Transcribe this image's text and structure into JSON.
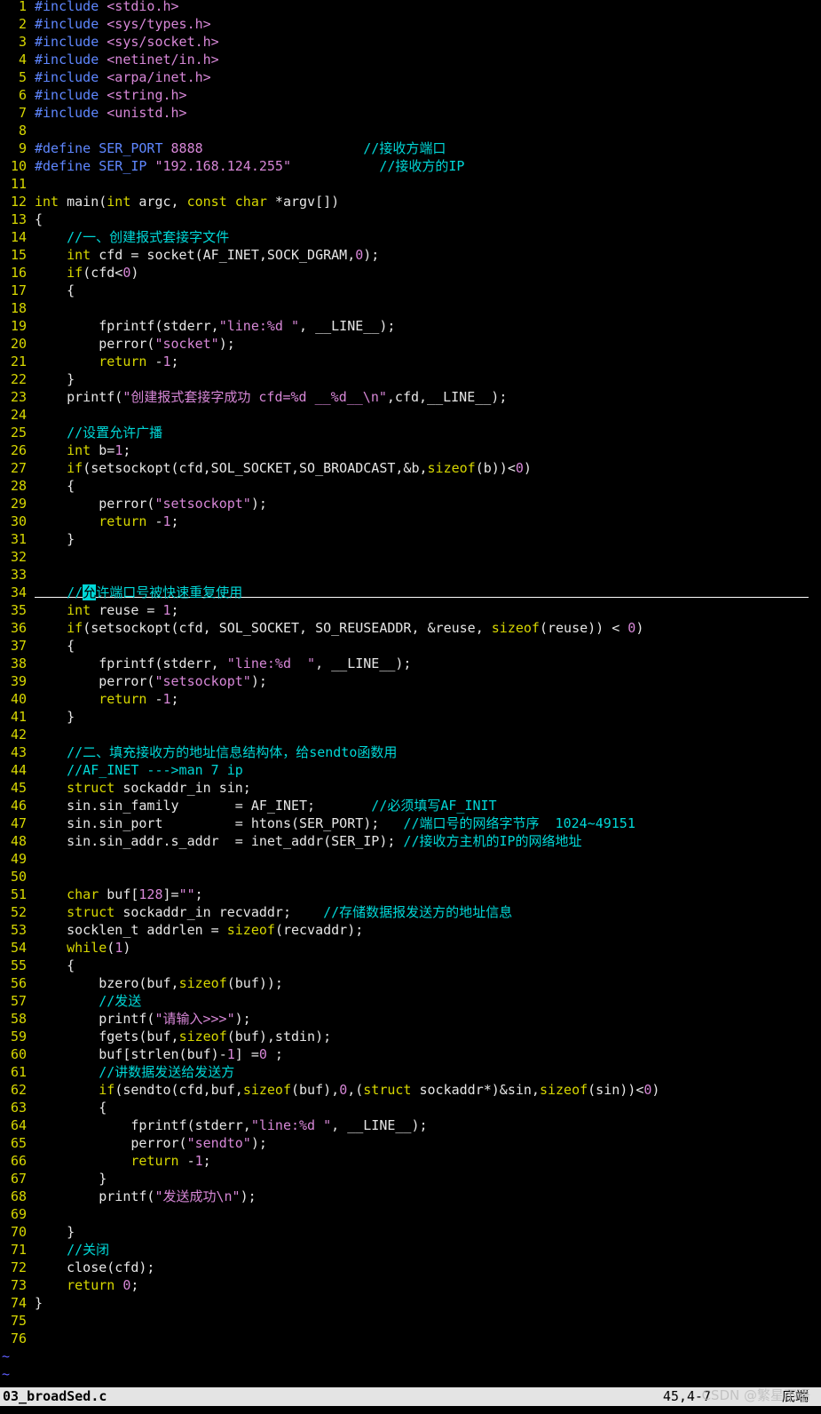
{
  "filename": "03_broadSed.c",
  "cursor_pos": "45,4-7",
  "scroll_pos": "底端",
  "watermark": "CSDN @繁星不语",
  "colors": {
    "background": "#000000",
    "line_number": "#d7d700",
    "comment": "#00d7d7",
    "string": "#d787d7",
    "keyword": "#d7d700",
    "preprocessor": "#5f87ff",
    "statusbar": "#e4e4e4"
  },
  "lines": [
    [
      [
        "pp",
        "#include "
      ],
      [
        "inc",
        "<stdio.h>"
      ]
    ],
    [
      [
        "pp",
        "#include "
      ],
      [
        "inc",
        "<sys/types.h>"
      ]
    ],
    [
      [
        "pp",
        "#include "
      ],
      [
        "inc",
        "<sys/socket.h>"
      ]
    ],
    [
      [
        "pp",
        "#include "
      ],
      [
        "inc",
        "<netinet/in.h>"
      ]
    ],
    [
      [
        "pp",
        "#include "
      ],
      [
        "inc",
        "<arpa/inet.h>"
      ]
    ],
    [
      [
        "pp",
        "#include "
      ],
      [
        "inc",
        "<string.h>"
      ]
    ],
    [
      [
        "pp",
        "#include "
      ],
      [
        "inc",
        "<unistd.h>"
      ]
    ],
    [],
    [
      [
        "pp",
        "#define SER_PORT "
      ],
      [
        "num",
        "8888"
      ],
      [
        "",
        "                    "
      ],
      [
        "cmt",
        "//接收方端口"
      ]
    ],
    [
      [
        "pp",
        "#define SER_IP "
      ],
      [
        "str",
        "\"192.168.124.255\""
      ],
      [
        "",
        "           "
      ],
      [
        "cmt",
        "//接收方的IP"
      ]
    ],
    [],
    [
      [
        "ty",
        "int"
      ],
      [
        "",
        " main("
      ],
      [
        "ty",
        "int"
      ],
      [
        "",
        " argc, "
      ],
      [
        "ty",
        "const"
      ],
      [
        "",
        " "
      ],
      [
        "ty",
        "char"
      ],
      [
        "",
        " *argv[])"
      ]
    ],
    [
      [
        "",
        "{"
      ]
    ],
    [
      [
        "",
        "    "
      ],
      [
        "cmt",
        "//一、创建报式套接字文件"
      ]
    ],
    [
      [
        "",
        "    "
      ],
      [
        "ty",
        "int"
      ],
      [
        "",
        " cfd = socket(AF_INET,SOCK_DGRAM,"
      ],
      [
        "num",
        "0"
      ],
      [
        "",
        ");"
      ]
    ],
    [
      [
        "",
        "    "
      ],
      [
        "kw",
        "if"
      ],
      [
        "",
        "(cfd<"
      ],
      [
        "num",
        "0"
      ],
      [
        "",
        ")"
      ]
    ],
    [
      [
        "",
        "    {"
      ]
    ],
    [],
    [
      [
        "",
        "        fprintf(stderr,"
      ],
      [
        "str",
        "\"line:%d \""
      ],
      [
        "",
        ", __LINE__);"
      ]
    ],
    [
      [
        "",
        "        perror("
      ],
      [
        "str",
        "\"socket\""
      ],
      [
        "",
        ");"
      ]
    ],
    [
      [
        "",
        "        "
      ],
      [
        "kw",
        "return"
      ],
      [
        "",
        " -"
      ],
      [
        "num",
        "1"
      ],
      [
        "",
        ";"
      ]
    ],
    [
      [
        "",
        "    }"
      ]
    ],
    [
      [
        "",
        "    printf("
      ],
      [
        "str",
        "\"创建报式套接字成功 cfd=%d __%d__\\n\""
      ],
      [
        "",
        ",cfd,__LINE__);"
      ]
    ],
    [],
    [
      [
        "",
        "    "
      ],
      [
        "cmt",
        "//设置允许广播"
      ]
    ],
    [
      [
        "",
        "    "
      ],
      [
        "ty",
        "int"
      ],
      [
        "",
        " b="
      ],
      [
        "num",
        "1"
      ],
      [
        "",
        ";"
      ]
    ],
    [
      [
        "",
        "    "
      ],
      [
        "kw",
        "if"
      ],
      [
        "",
        "(setsockopt(cfd,SOL_SOCKET,SO_BROADCAST,&b,"
      ],
      [
        "kw",
        "sizeof"
      ],
      [
        "",
        "(b))<"
      ],
      [
        "num",
        "0"
      ],
      [
        "",
        ")"
      ]
    ],
    [
      [
        "",
        "    {"
      ]
    ],
    [
      [
        "",
        "        perror("
      ],
      [
        "str",
        "\"setsockopt\""
      ],
      [
        "",
        ");"
      ]
    ],
    [
      [
        "",
        "        "
      ],
      [
        "kw",
        "return"
      ],
      [
        "",
        " -"
      ],
      [
        "num",
        "1"
      ],
      [
        "",
        ";"
      ]
    ],
    [
      [
        "",
        "    }"
      ]
    ],
    [],
    [],
    [
      [
        "",
        "    "
      ],
      [
        "cmt",
        "//"
      ],
      [
        "cursor",
        "允"
      ],
      [
        "cmt",
        "许端口号被快速重复使用"
      ]
    ],
    [
      [
        "",
        "    "
      ],
      [
        "ty",
        "int"
      ],
      [
        "",
        " reuse = "
      ],
      [
        "num",
        "1"
      ],
      [
        "",
        ";"
      ]
    ],
    [
      [
        "",
        "    "
      ],
      [
        "kw",
        "if"
      ],
      [
        "",
        "(setsockopt(cfd, SOL_SOCKET, SO_REUSEADDR, &reuse, "
      ],
      [
        "kw",
        "sizeof"
      ],
      [
        "",
        "(reuse)) < "
      ],
      [
        "num",
        "0"
      ],
      [
        "",
        ")"
      ]
    ],
    [
      [
        "",
        "    {"
      ]
    ],
    [
      [
        "",
        "        fprintf(stderr, "
      ],
      [
        "str",
        "\"line:%d  \""
      ],
      [
        "",
        ", __LINE__);"
      ]
    ],
    [
      [
        "",
        "        perror("
      ],
      [
        "str",
        "\"setsockopt\""
      ],
      [
        "",
        ");"
      ]
    ],
    [
      [
        "",
        "        "
      ],
      [
        "kw",
        "return"
      ],
      [
        "",
        " -"
      ],
      [
        "num",
        "1"
      ],
      [
        "",
        ";"
      ]
    ],
    [
      [
        "",
        "    }"
      ]
    ],
    [],
    [
      [
        "",
        "    "
      ],
      [
        "cmt",
        "//二、填充接收方的地址信息结构体，给sendto函数用"
      ]
    ],
    [
      [
        "",
        "    "
      ],
      [
        "cmt",
        "//AF_INET --->man 7 ip"
      ]
    ],
    [
      [
        "",
        "    "
      ],
      [
        "ty",
        "struct"
      ],
      [
        "",
        " sockaddr_in sin;"
      ]
    ],
    [
      [
        "",
        "    sin.sin_family       = AF_INET;       "
      ],
      [
        "cmt",
        "//必须填写AF_INIT"
      ]
    ],
    [
      [
        "",
        "    sin.sin_port         = htons(SER_PORT);   "
      ],
      [
        "cmt",
        "//端口号的网络字节序  1024~49151"
      ]
    ],
    [
      [
        "",
        "    sin.sin_addr.s_addr  = inet_addr(SER_IP); "
      ],
      [
        "cmt",
        "//接收方主机的IP的网络地址"
      ]
    ],
    [],
    [],
    [
      [
        "",
        "    "
      ],
      [
        "ty",
        "char"
      ],
      [
        "",
        " buf["
      ],
      [
        "num",
        "128"
      ],
      [
        "",
        "]="
      ],
      [
        "str",
        "\"\""
      ],
      [
        "",
        ";"
      ]
    ],
    [
      [
        "",
        "    "
      ],
      [
        "ty",
        "struct"
      ],
      [
        "",
        " sockaddr_in recvaddr;    "
      ],
      [
        "cmt",
        "//存储数据报发送方的地址信息"
      ]
    ],
    [
      [
        "",
        "    socklen_t addrlen = "
      ],
      [
        "kw",
        "sizeof"
      ],
      [
        "",
        "(recvaddr);"
      ]
    ],
    [
      [
        "",
        "    "
      ],
      [
        "kw",
        "while"
      ],
      [
        "",
        "("
      ],
      [
        "num",
        "1"
      ],
      [
        "",
        ")"
      ]
    ],
    [
      [
        "",
        "    {"
      ]
    ],
    [
      [
        "",
        "        bzero(buf,"
      ],
      [
        "kw",
        "sizeof"
      ],
      [
        "",
        "(buf));"
      ]
    ],
    [
      [
        "",
        "        "
      ],
      [
        "cmt",
        "//发送"
      ]
    ],
    [
      [
        "",
        "        printf("
      ],
      [
        "str",
        "\"请输入>>>\""
      ],
      [
        "",
        ");"
      ]
    ],
    [
      [
        "",
        "        fgets(buf,"
      ],
      [
        "kw",
        "sizeof"
      ],
      [
        "",
        "(buf),stdin);"
      ]
    ],
    [
      [
        "",
        "        buf[strlen(buf)-"
      ],
      [
        "num",
        "1"
      ],
      [
        "",
        "] ="
      ],
      [
        "num",
        "0"
      ],
      [
        "",
        " ;"
      ]
    ],
    [
      [
        "",
        "        "
      ],
      [
        "cmt",
        "//讲数据发送给发送方"
      ]
    ],
    [
      [
        "",
        "        "
      ],
      [
        "kw",
        "if"
      ],
      [
        "",
        "(sendto(cfd,buf,"
      ],
      [
        "kw",
        "sizeof"
      ],
      [
        "",
        "(buf),"
      ],
      [
        "num",
        "0"
      ],
      [
        "",
        ",("
      ],
      [
        "ty",
        "struct"
      ],
      [
        "",
        " sockaddr*)&sin,"
      ],
      [
        "kw",
        "sizeof"
      ],
      [
        "",
        "(sin))<"
      ],
      [
        "num",
        "0"
      ],
      [
        "",
        ")"
      ]
    ],
    [
      [
        "",
        "        {"
      ]
    ],
    [
      [
        "",
        "            fprintf(stderr,"
      ],
      [
        "str",
        "\"line:%d \""
      ],
      [
        "",
        ", __LINE__);"
      ]
    ],
    [
      [
        "",
        "            perror("
      ],
      [
        "str",
        "\"sendto\""
      ],
      [
        "",
        ");"
      ]
    ],
    [
      [
        "",
        "            "
      ],
      [
        "kw",
        "return"
      ],
      [
        "",
        " -"
      ],
      [
        "num",
        "1"
      ],
      [
        "",
        ";"
      ]
    ],
    [
      [
        "",
        "        }"
      ]
    ],
    [
      [
        "",
        "        printf("
      ],
      [
        "str",
        "\"发送成功\\n\""
      ],
      [
        "",
        ");"
      ]
    ],
    [],
    [
      [
        "",
        "    }"
      ]
    ],
    [
      [
        "",
        "    "
      ],
      [
        "cmt",
        "//关闭"
      ]
    ],
    [
      [
        "",
        "    close(cfd);"
      ]
    ],
    [
      [
        "",
        "    "
      ],
      [
        "kw",
        "return"
      ],
      [
        "",
        " "
      ],
      [
        "num",
        "0"
      ],
      [
        "",
        ";"
      ]
    ],
    [
      [
        "",
        "}"
      ]
    ],
    [],
    []
  ],
  "tildes": [
    "~",
    "~"
  ]
}
